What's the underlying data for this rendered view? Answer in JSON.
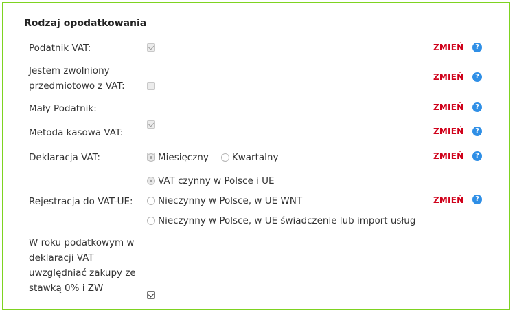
{
  "section": {
    "title": "Rodzaj opodatkowania"
  },
  "change_label": "ZMIEŃ",
  "help_glyph": "?",
  "colors": {
    "border": "#7ed321",
    "change": "#d0021b",
    "help": "#2f8fe6"
  },
  "rows": {
    "vat_payer": {
      "label": "Podatnik VAT:",
      "checked": true,
      "disabled": true
    },
    "exempt": {
      "label_line1": "Jestem zwolniony",
      "label_line2": "przedmiotowo z VAT:",
      "checked": false,
      "disabled": true
    },
    "small_taxpayer": {
      "label": "Mały Podatnik:",
      "checked": true,
      "disabled": true
    },
    "cash_method": {
      "label": "Metoda kasowa VAT:",
      "checked": true,
      "disabled": true
    },
    "declaration": {
      "label": "Deklaracja VAT:",
      "options": [
        "Miesięczny",
        "Kwartalny"
      ],
      "selected": "Miesięczny"
    },
    "registration": {
      "label": "Rejestracja do VAT-UE:",
      "options": [
        "VAT czynny w Polsce i UE",
        "Nieczynny w Polsce, w UE WNT",
        "Nieczynny w Polsce, w UE świadczenie lub import usług"
      ],
      "selected": "VAT czynny w Polsce i UE"
    },
    "zero_rate": {
      "label_lines": [
        "W roku podatkowym w",
        "deklaracji VAT",
        "uwzględniać zakupy ze",
        "stawką 0% i ZW"
      ],
      "checked": true,
      "disabled": false
    }
  }
}
